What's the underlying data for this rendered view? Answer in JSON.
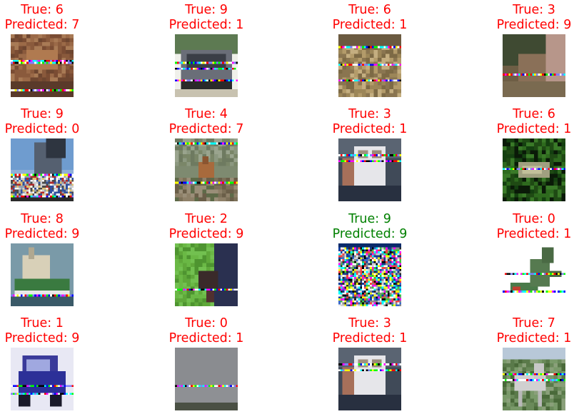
{
  "colors": {
    "incorrect": "#ff0000",
    "correct": "#008000"
  },
  "chart_data": {
    "type": "image-grid",
    "rows": 4,
    "columns": 4,
    "panels": [
      {
        "true_label": "True: 6",
        "predicted_label": "Predicted: 7",
        "correct": false,
        "scene": "frog-brown"
      },
      {
        "true_label": "True: 9",
        "predicted_label": "Predicted: 1",
        "correct": false,
        "scene": "truck"
      },
      {
        "true_label": "True: 6",
        "predicted_label": "Predicted: 1",
        "correct": false,
        "scene": "frog-ground"
      },
      {
        "true_label": "True: 3",
        "predicted_label": "Predicted: 9",
        "correct": false,
        "scene": "cat-dark"
      },
      {
        "true_label": "True: 9",
        "predicted_label": "Predicted: 0",
        "correct": false,
        "scene": "truck-sky"
      },
      {
        "true_label": "True: 4",
        "predicted_label": "Predicted: 7",
        "correct": false,
        "scene": "deer"
      },
      {
        "true_label": "True: 3",
        "predicted_label": "Predicted: 1",
        "correct": false,
        "scene": "cat-white"
      },
      {
        "true_label": "True: 6",
        "predicted_label": "Predicted: 1",
        "correct": false,
        "scene": "frog-green"
      },
      {
        "true_label": "True: 8",
        "predicted_label": "Predicted: 9",
        "correct": false,
        "scene": "ship"
      },
      {
        "true_label": "True: 2",
        "predicted_label": "Predicted: 9",
        "correct": false,
        "scene": "bird-grass"
      },
      {
        "true_label": "True: 9",
        "predicted_label": "Predicted: 9",
        "correct": true,
        "scene": "noise"
      },
      {
        "true_label": "True: 0",
        "predicted_label": "Predicted: 1",
        "correct": false,
        "scene": "airplane"
      },
      {
        "true_label": "True: 1",
        "predicted_label": "Predicted: 9",
        "correct": false,
        "scene": "car-blue"
      },
      {
        "true_label": "True: 0",
        "predicted_label": "Predicted: 1",
        "correct": false,
        "scene": "sky-gray"
      },
      {
        "true_label": "True: 3",
        "predicted_label": "Predicted: 1",
        "correct": false,
        "scene": "cat-white"
      },
      {
        "true_label": "True: 7",
        "predicted_label": "Predicted: 1",
        "correct": false,
        "scene": "horse"
      }
    ]
  }
}
